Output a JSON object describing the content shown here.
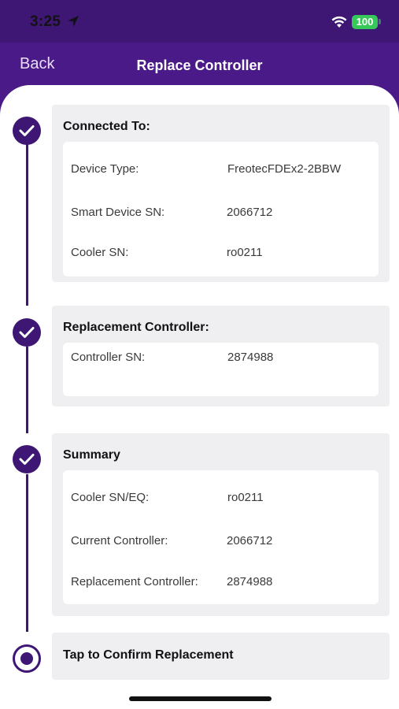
{
  "status": {
    "time": "3:25",
    "battery": "100"
  },
  "nav": {
    "back": "Back",
    "title": "Replace Controller"
  },
  "connected": {
    "title": "Connected To:",
    "rows": [
      {
        "label": "Device Type:",
        "value": "FreotecFDEx2-2BBW"
      },
      {
        "label": "Smart Device SN:",
        "value": "2066712"
      },
      {
        "label": "Cooler SN:",
        "value": "ro0211"
      }
    ]
  },
  "replacement": {
    "title": "Replacement Controller:",
    "rows": [
      {
        "label": "Controller SN:",
        "value": "2874988"
      }
    ]
  },
  "summary": {
    "title": "Summary",
    "rows": [
      {
        "label": "Cooler SN/EQ:",
        "value": "ro0211"
      },
      {
        "label": "Current Controller:",
        "value": "2066712"
      },
      {
        "label": "Replacement Controller:",
        "value": "2874988"
      }
    ]
  },
  "confirm": {
    "title": "Tap to Confirm Replacement"
  },
  "colors": {
    "primary": "#3e1775",
    "header": "#4a1a88",
    "card": "#efeff2",
    "battery": "#38c759"
  }
}
